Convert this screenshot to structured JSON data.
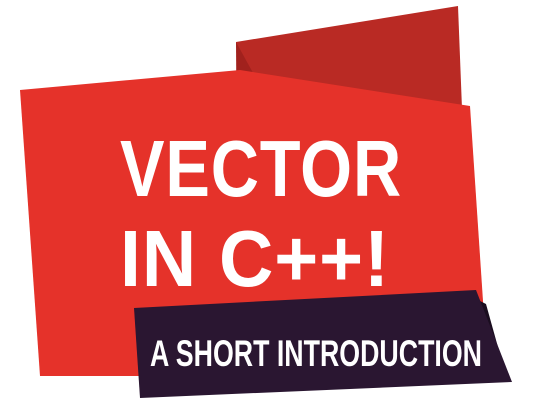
{
  "banner": {
    "title_line_1": "VECTOR",
    "title_line_2": "IN C++!",
    "subtitle": "A SHORT INTRODUCTION"
  },
  "colors": {
    "red_main": "#e5322a",
    "red_dark": "#b92a24",
    "red_shadow": "#a1211d",
    "ribbon": "#2a1631",
    "text": "#ffffff"
  }
}
